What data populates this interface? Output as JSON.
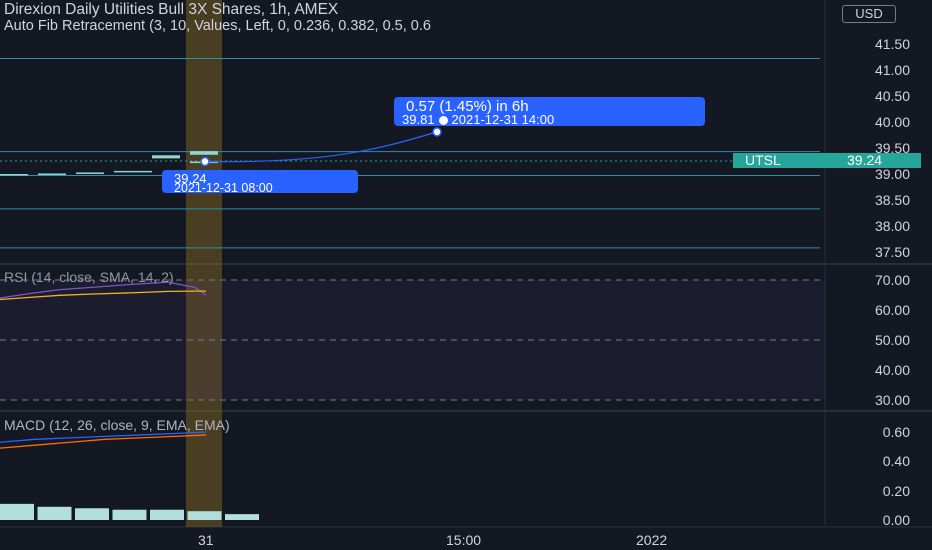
{
  "header": {
    "title": "Direxion Daily Utilities Bull 3X Shares, 1h, AMEX",
    "fib_indicator": "Auto Fib Retracement (3, 10, Values, Left, 0, 0.236, 0.382, 0.5, 0.6",
    "currency_button": "USD"
  },
  "price_axis": {
    "labels": [
      "41.50",
      "41.00",
      "40.50",
      "40.00",
      "39.50",
      "39.00",
      "38.50",
      "38.00",
      "37.50"
    ]
  },
  "symbol_tag": {
    "symbol": "UTSL",
    "price": "39.24"
  },
  "callout": {
    "change": "0.57 (1.45%) in 6h",
    "target": "39.81",
    "target_time": "2021-12-31  14:00"
  },
  "crosshair_tag": {
    "price": "39.24",
    "time": "2021-12-31 08:00"
  },
  "rsi": {
    "title": "RSI (14, close, SMA, 14, 2)",
    "axis_labels": [
      "70.00",
      "60.00",
      "50.00",
      "40.00",
      "30.00"
    ]
  },
  "macd": {
    "title": "MACD (12, 26, close, 9, EMA, EMA)",
    "axis_labels": [
      "0.60",
      "0.40",
      "0.20",
      "0.00"
    ]
  },
  "time_axis": {
    "labels": [
      "31",
      "15:00",
      "2022"
    ]
  },
  "colors": {
    "background": "#141823",
    "fib_line": "#2b8fb0",
    "up_candle": "#8fd8cf",
    "highlight_column": "#8a6b22",
    "annotation_blue": "#2962ff",
    "rsi_line": "#7e57c2",
    "rsi_signal": "#f0b429",
    "macd_line": "#2962ff",
    "macd_signal": "#ff6d00",
    "histogram": "#b2dfdb",
    "accent_teal": "#26a69a"
  },
  "chart_data": [
    {
      "type": "line",
      "title": "Direxion Daily Utilities Bull 3X Shares, 1h, AMEX",
      "ylim": [
        37.3,
        41.95
      ],
      "fib_levels": [
        41.22,
        39.43,
        38.97,
        38.33,
        37.58
      ],
      "current_price": 39.24,
      "bars": [
        {
          "x_index": 0,
          "open": 38.99,
          "close": 39.0
        },
        {
          "x_index": 1,
          "open": 39.0,
          "close": 39.01
        },
        {
          "x_index": 2,
          "open": 39.02,
          "close": 39.03
        },
        {
          "x_index": 3,
          "open": 39.04,
          "close": 39.06
        },
        {
          "x_index": 4,
          "open": 39.3,
          "close": 39.36
        },
        {
          "x_index": 5,
          "open": 39.37,
          "close": 39.44
        },
        {
          "x_index": 6,
          "open": 39.21,
          "close": 39.24
        }
      ],
      "projection": {
        "from_price": 39.24,
        "to_price": 39.81,
        "label": "0.57 (1.45%) in 6h"
      }
    },
    {
      "type": "line",
      "title": "RSI (14, close, SMA, 14, 2)",
      "ylim": [
        30,
        70
      ],
      "series": [
        {
          "values": [
            64.0,
            65.5,
            66.8,
            67.5,
            68.5,
            69.3,
            67.5,
            65.0
          ]
        },
        {
          "values": [
            63.5,
            64.2,
            64.9,
            65.3,
            65.7,
            66.2,
            66.3,
            66.3
          ]
        }
      ]
    },
    {
      "type": "bar",
      "title": "MACD (12, 26, close, 9, EMA, EMA)",
      "ylim": [
        -0.03,
        0.7
      ],
      "histogram": [
        0.11,
        0.09,
        0.08,
        0.07,
        0.07,
        0.06,
        0.04
      ],
      "series": [
        {
          "values": [
            0.53,
            0.55,
            0.56,
            0.57,
            0.58,
            0.59,
            0.6
          ]
        },
        {
          "values": [
            0.49,
            0.51,
            0.53,
            0.55,
            0.56,
            0.57,
            0.58
          ]
        }
      ]
    }
  ]
}
